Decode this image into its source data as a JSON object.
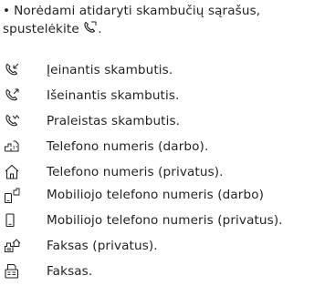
{
  "intro": {
    "bullet": "•",
    "text_before": "Norėdami atidaryti skambučių sąrašus, spustelėkite",
    "text_after": ".",
    "icon": "handset-icon"
  },
  "items": [
    {
      "icon": "incoming-call-icon",
      "label": "Įeinantis skambutis."
    },
    {
      "icon": "outgoing-call-icon",
      "label": "Išeinantis skambutis."
    },
    {
      "icon": "missed-call-icon",
      "label": "Praleistas skambutis."
    },
    {
      "icon": "work-phone-icon",
      "label": "Telefono numeris (darbo)."
    },
    {
      "icon": "home-phone-icon",
      "label": "Telefono numeris (privatus)."
    },
    {
      "icon": "work-mobile-icon",
      "label": "Mobiliojo telefono numeris (darbo)"
    },
    {
      "icon": "mobile-phone-icon",
      "label": "Mobiliojo telefono numeris (privatus)."
    },
    {
      "icon": "home-fax-icon",
      "label": "Faksas (privatus)."
    },
    {
      "icon": "fax-icon",
      "label": "Faksas."
    }
  ]
}
